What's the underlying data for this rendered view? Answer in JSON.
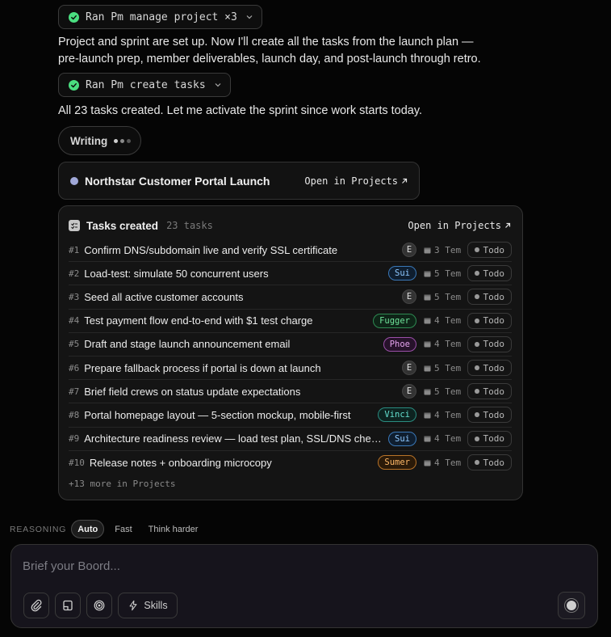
{
  "messages": {
    "tool1": {
      "label": "Ran Pm manage project ×3"
    },
    "para1": "Project and sprint are set up. Now I'll create all the tasks from the launch plan — pre-launch prep, member deliverables, launch day, and post-launch through retro.",
    "tool2": {
      "label": "Ran Pm create tasks"
    },
    "para2": "All 23 tasks created. Let me activate the sprint since work starts today.",
    "writing": "Writing"
  },
  "project_card": {
    "title": "Northstar Customer Portal Launch",
    "link": "Open in Projects",
    "dot_color": "#a0a8d8"
  },
  "tasks_card": {
    "title": "Tasks created",
    "count": "23 tasks",
    "link": "Open in Projects",
    "more": "+13 more in Projects",
    "rows": [
      {
        "num": "#1",
        "title": "Confirm DNS/subdomain live and verify SSL certificate",
        "assignee": "E",
        "assignee_style": "e",
        "due": "3 Tem",
        "status": "Todo"
      },
      {
        "num": "#2",
        "title": "Load-test: simulate 50 concurrent users",
        "assignee": "Sui",
        "assignee_style": "blue",
        "due": "5 Tem",
        "status": "Todo"
      },
      {
        "num": "#3",
        "title": "Seed all active customer accounts",
        "assignee": "E",
        "assignee_style": "e",
        "due": "5 Tem",
        "status": "Todo"
      },
      {
        "num": "#4",
        "title": "Test payment flow end-to-end with $1 test charge",
        "assignee": "Fugger",
        "assignee_style": "green",
        "due": "4 Tem",
        "status": "Todo"
      },
      {
        "num": "#5",
        "title": "Draft and stage launch announcement email",
        "assignee": "Phoe",
        "assignee_style": "purple",
        "due": "4 Tem",
        "status": "Todo"
      },
      {
        "num": "#6",
        "title": "Prepare fallback process if portal is down at launch",
        "assignee": "E",
        "assignee_style": "e",
        "due": "5 Tem",
        "status": "Todo"
      },
      {
        "num": "#7",
        "title": "Brief field crews on status update expectations",
        "assignee": "E",
        "assignee_style": "e",
        "due": "5 Tem",
        "status": "Todo"
      },
      {
        "num": "#8",
        "title": "Portal homepage layout — 5-section mockup, mobile-first",
        "assignee": "Vinci",
        "assignee_style": "teal",
        "due": "4 Tem",
        "status": "Todo"
      },
      {
        "num": "#9",
        "title": "Architecture readiness review — load test plan, SSL/DNS checklist",
        "assignee": "Sui",
        "assignee_style": "blue",
        "due": "4 Tem",
        "status": "Todo"
      },
      {
        "num": "#10",
        "title": "Release notes + onboarding microcopy",
        "assignee": "Sumer",
        "assignee_style": "orange",
        "due": "4 Tem",
        "status": "Todo"
      }
    ]
  },
  "reasoning": {
    "label": "REASONING",
    "options": [
      "Auto",
      "Fast",
      "Think harder"
    ],
    "selected": "Auto"
  },
  "composer": {
    "placeholder": "Brief your Boord...",
    "skills_label": "Skills",
    "tools": [
      "paperclip-icon",
      "document-icon",
      "target-icon"
    ]
  },
  "colors": {
    "background": "#050505",
    "success": "#4ade80",
    "composer_bg": "#16141c"
  }
}
